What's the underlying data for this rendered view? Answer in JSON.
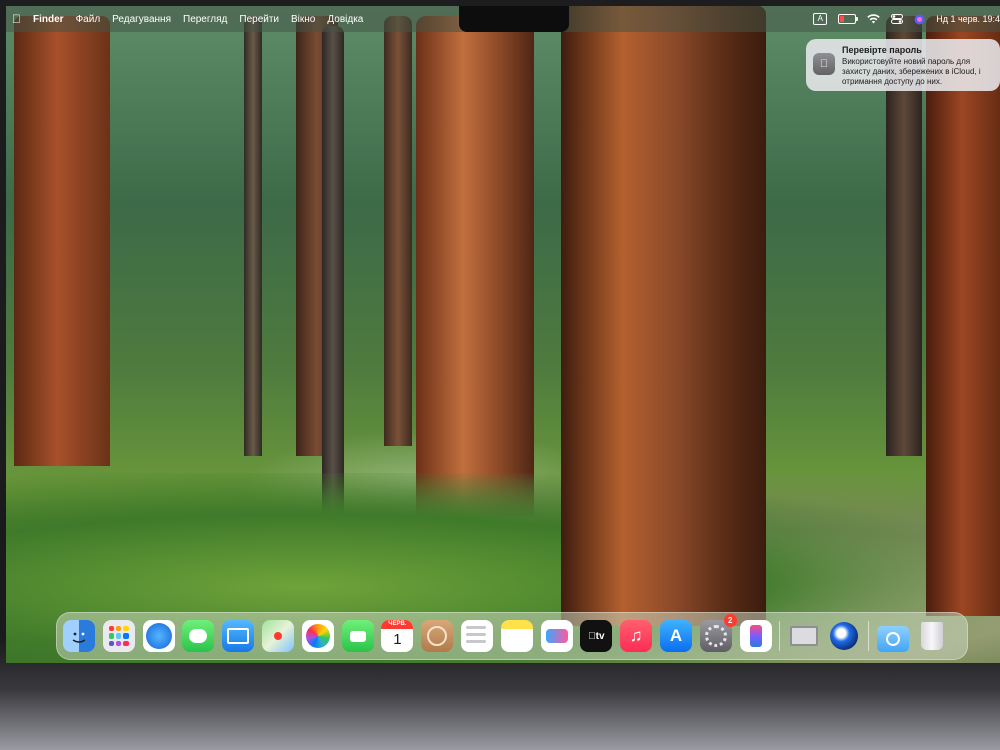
{
  "menubar": {
    "apple_icon": "apple-logo",
    "app_name": "Finder",
    "menus": [
      "Файл",
      "Редагування",
      "Перегляд",
      "Перейти",
      "Вікно",
      "Довідка"
    ],
    "status_icons": [
      "keyboard-layout-icon",
      "battery-icon",
      "wifi-icon",
      "control-center-icon",
      "siri-icon"
    ],
    "keyboard_layout": "A",
    "clock": "Нд 1 черв.  19:4"
  },
  "notification": {
    "icon": "apple-logo",
    "title": "Перевірте пароль",
    "body": "Використовуйте новий пароль для захисту даних, збережених в iCloud, і отримання доступу до них."
  },
  "dock": {
    "apps": [
      {
        "name": "Finder",
        "icon": "finder-icon"
      },
      {
        "name": "Launchpad",
        "icon": "launchpad-icon"
      },
      {
        "name": "Safari",
        "icon": "safari-icon"
      },
      {
        "name": "Messages",
        "icon": "messages-icon"
      },
      {
        "name": "Mail",
        "icon": "mail-icon"
      },
      {
        "name": "Maps",
        "icon": "maps-icon"
      },
      {
        "name": "Photos",
        "icon": "photos-icon"
      },
      {
        "name": "FaceTime",
        "icon": "facetime-icon"
      },
      {
        "name": "Calendar",
        "icon": "calendar-icon"
      },
      {
        "name": "Contacts",
        "icon": "contacts-icon"
      },
      {
        "name": "Reminders",
        "icon": "reminders-icon"
      },
      {
        "name": "Notes",
        "icon": "notes-icon"
      },
      {
        "name": "Freeform",
        "icon": "freeform-icon"
      },
      {
        "name": "TV",
        "icon": "apple-tv-icon"
      },
      {
        "name": "Music",
        "icon": "music-icon"
      },
      {
        "name": "App Store",
        "icon": "app-store-icon"
      },
      {
        "name": "System Settings",
        "icon": "system-settings-icon"
      },
      {
        "name": "iPhone Mirroring",
        "icon": "iphone-mirroring-icon"
      }
    ],
    "calendar_month": "ЧЕРВ.",
    "calendar_day": "1",
    "tv_label": "tv",
    "settings_badge": "2",
    "extra": [
      {
        "name": "Migration Assistant",
        "icon": "migration-assistant-icon"
      },
      {
        "name": "Cinema 4D",
        "icon": "cinema-4d-icon"
      }
    ],
    "stacks": [
      {
        "name": "Downloads",
        "icon": "downloads-folder-icon"
      },
      {
        "name": "Trash",
        "icon": "trash-icon"
      }
    ]
  }
}
